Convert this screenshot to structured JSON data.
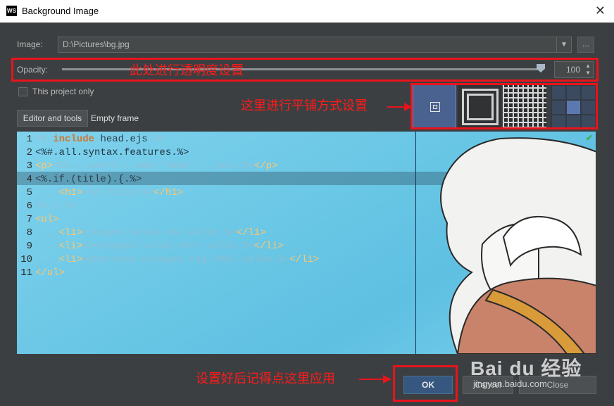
{
  "window": {
    "title": "Background Image",
    "app_icon": "WS"
  },
  "form": {
    "image_label": "Image:",
    "image_path": "D:\\Pictures\\bg.jpg",
    "browse_label": "...",
    "opacity_label": "Opacity:",
    "opacity_value": "100",
    "opacity_level": 100,
    "project_only_label": "This project only",
    "project_only_checked": false
  },
  "tabs": [
    {
      "label": "Editor and tools",
      "active": true
    },
    {
      "label": "Empty frame",
      "active": false
    }
  ],
  "code_lines": [
    {
      "n": "1",
      "html": "<span class='t-dim'>&lt;%</span><span class='t-dim'>.</span><span class='t-kw'>include</span><span class='t-dim'>.</span><span class='t-plain'>head.ejs</span><span class='t-dim'>.%&gt;</span>"
    },
    {
      "n": "2",
      "html": "<span class='t-b'>&lt;%#.all.syntax.features.%&gt;</span>"
    },
    {
      "n": "3",
      "html": "<span class='t-tag'>&lt;p&gt;</span><span class='t-dim'>&lt;%=.:.users.|.map:'name'.|.join.%&gt;</span><span class='t-tag'>&lt;/p&gt;</span>"
    },
    {
      "n": "4",
      "html": "<span class='t-plain'>&lt;%.if.(title).{.%&gt;</span>"
    },
    {
      "n": "5",
      "html": "<span class='t-dim'>....</span><span class='t-tag'>&lt;h1&gt;</span><span class='t-dim'>&lt;%=.title.%&gt;</span><span class='t-tag'>&lt;/h1&gt;</span>"
    },
    {
      "n": "6",
      "html": "<span class='t-dim'>&lt;%.}.%&gt;</span>"
    },
    {
      "n": "7",
      "html": "<span class='t-tag'>&lt;ul&gt;</span>"
    },
    {
      "n": "8",
      "html": "<span class='t-dim'>....</span><span class='t-tag'>&lt;li&gt;</span><span class='t-dim'>Escaped.value.&lt;%=.value.%&gt;</span><span class='t-tag'>&lt;/li&gt;</span>"
    },
    {
      "n": "9",
      "html": "<span class='t-dim'>....</span><span class='t-tag'>&lt;li&gt;</span><span class='t-dim'>Unescaped.value.&lt;%==.value.%&gt;</span><span class='t-tag'>&lt;/li&gt;</span>"
    },
    {
      "n": "10",
      "html": "<span class='t-dim'>....</span><span class='t-tag'>&lt;li&gt;</span><span class='t-dim'>Generated.escaped.tag.&lt;%%=.value.%&gt;</span><span class='t-tag'>&lt;/li&gt;</span>"
    },
    {
      "n": "11",
      "html": "<span class='t-tag'>&lt;/ul&gt;</span>"
    }
  ],
  "buttons": {
    "ok": "OK",
    "cancel": "Cancel",
    "close": "Close"
  },
  "annotations": {
    "opacity": "此处进行透明度设置",
    "tiling": "这里进行平铺方式设置",
    "apply": "设置好后记得点这里应用"
  },
  "watermark": {
    "logo": "Bai du 经验",
    "url": "jingyan.baidu.com"
  },
  "colors": {
    "annotation_red": "#e8141c",
    "ok_button": "#365880",
    "preview_bg": "#6cc8e6"
  }
}
